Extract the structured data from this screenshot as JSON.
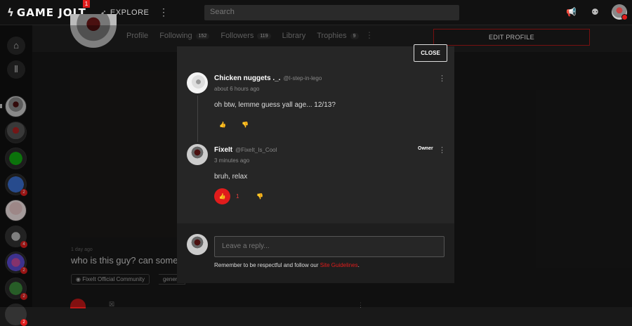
{
  "topbar": {
    "logo": "GAME JOLT",
    "logo_badge": "1",
    "explore": "EXPLORE",
    "search_placeholder": "Search"
  },
  "sidebar": {
    "badges": [
      "2",
      "4",
      "2",
      "2",
      "2"
    ]
  },
  "profile": {
    "tabs": [
      {
        "label": "Profile",
        "count": ""
      },
      {
        "label": "Following",
        "count": "152"
      },
      {
        "label": "Followers",
        "count": "119"
      },
      {
        "label": "Library",
        "count": ""
      },
      {
        "label": "Trophies",
        "count": "9"
      }
    ],
    "edit_profile": "EDIT PROFILE"
  },
  "background_post": {
    "time": "1 day ago",
    "title": "who is this guy? can somed",
    "tag_community": "FixeIt Official Community",
    "tag_channel": "genera"
  },
  "modal": {
    "close": "CLOSE",
    "comments": [
      {
        "name": "Chicken nuggets ._.",
        "handle": "@I-step-in-lego",
        "time": "about 6 hours ago",
        "text": "oh btw, lemme guess yall age... 12/13?",
        "likes": ""
      },
      {
        "name": "FixeIt",
        "handle": "@FixeIt_Is_Cool",
        "time": "3 minutes ago",
        "text": "bruh, relax",
        "likes": "1",
        "owner_label": "Owner"
      }
    ],
    "reply_placeholder": "Leave a reply...",
    "reply_note": "Remember to be respectful and follow our",
    "reply_link": "Site Guidelines",
    "reply_period": "."
  },
  "colors": {
    "accent": "#e01c1c",
    "modal_bg": "#262626"
  }
}
